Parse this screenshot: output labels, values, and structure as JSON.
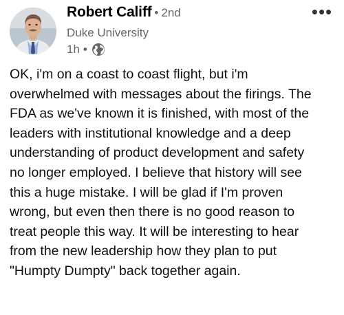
{
  "post": {
    "author": {
      "name": "Robert Califf",
      "connection": "2nd",
      "connection_dot": "•",
      "headline": "Duke University"
    },
    "time": "1h",
    "time_dot": "•",
    "visibility_icon": "globe-icon",
    "more_icon": "more-options-icon",
    "more_label": "•••",
    "text": "OK, i'm on a coast to coast flight, but i'm\noverwhelmed with messages about the firings. The\nFDA as we've known it is finished, with most of the\nleaders with institutional knowledge and a deep\nunderstanding of product development and safety\nno longer employed. I believe that history will see\nthis a huge mistake. I will be glad if I'm proven\nwrong, but even then there is no good reason to\ntreat people this way. It will be interesting to hear\nfrom the new leadership how they plan to put\n\"Humpty Dumpty\" back together again."
  },
  "colors": {
    "name": "#000000",
    "secondary": "#666666",
    "body": "#111111",
    "background": "#ffffff"
  }
}
